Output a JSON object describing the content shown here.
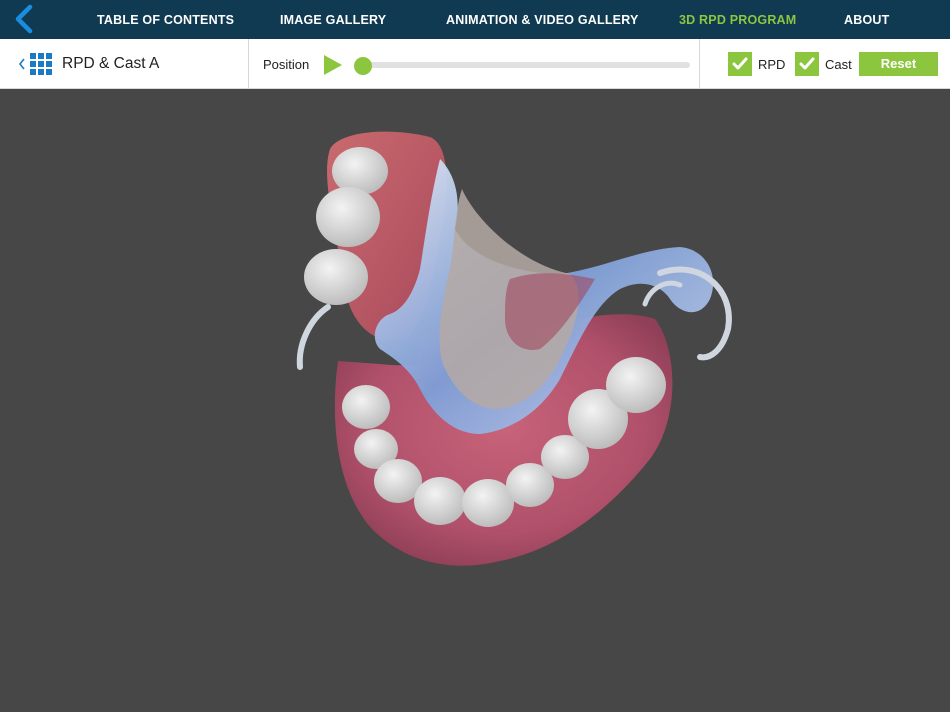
{
  "nav": {
    "items": [
      {
        "label": "TABLE OF CONTENTS",
        "active": false
      },
      {
        "label": "IMAGE GALLERY",
        "active": false
      },
      {
        "label": "ANIMATION & VIDEO GALLERY",
        "active": false
      },
      {
        "label": "3D RPD PROGRAM",
        "active": true
      },
      {
        "label": "ABOUT",
        "active": false
      }
    ],
    "active_color": "#8cc63f",
    "background": "#0f3a52"
  },
  "toolbar": {
    "title": "RPD & Cast A",
    "position_label": "Position",
    "position_value": 0.0,
    "checkboxes": [
      {
        "label": "RPD",
        "checked": true
      },
      {
        "label": "Cast",
        "checked": true
      }
    ],
    "reset_label": "Reset",
    "accent": "#8cc63f",
    "icons": {
      "back": "back-chevron-icon",
      "menu": "grid-menu-icon",
      "play": "play-icon",
      "check": "checkmark-icon"
    }
  },
  "viewport": {
    "background": "#474747",
    "content": "3D model of removable partial denture on dental cast"
  }
}
